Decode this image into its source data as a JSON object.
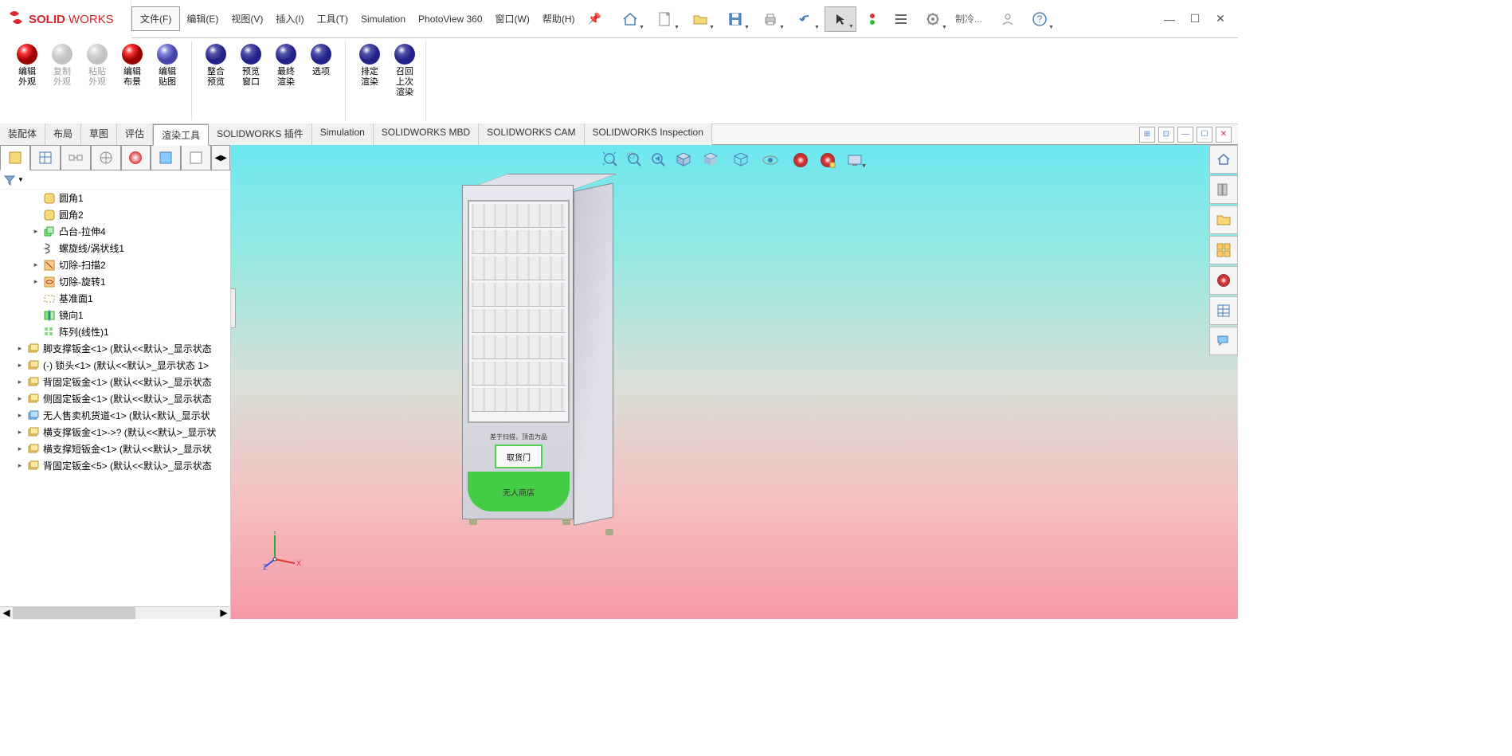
{
  "logo": "SOLIDWORKS",
  "menu": {
    "file": "文件(F)",
    "edit": "编辑(E)",
    "view": "视图(V)",
    "insert": "插入(I)",
    "tools": "工具(T)",
    "simulation": "Simulation",
    "photoview": "PhotoView 360",
    "window": "窗口(W)",
    "help": "帮助(H)"
  },
  "searchPlaceholder": "制冷...",
  "ribbon": {
    "items": [
      {
        "label": "编辑\n外观",
        "icon": "appearance"
      },
      {
        "label": "复制\n外观",
        "icon": "copy-appearance",
        "disabled": true
      },
      {
        "label": "粘贴\n外观",
        "icon": "paste-appearance",
        "disabled": true
      },
      {
        "label": "编辑\n布景",
        "icon": "scene"
      },
      {
        "label": "编辑\n贴图",
        "icon": "decal"
      },
      {
        "label": "整合\n预览",
        "icon": "integrated-preview"
      },
      {
        "label": "预览\n窗口",
        "icon": "preview-window"
      },
      {
        "label": "最终\n渲染",
        "icon": "final-render"
      },
      {
        "label": "选项",
        "icon": "options"
      },
      {
        "label": "排定\n渲染",
        "icon": "schedule"
      },
      {
        "label": "召回\n上次\n渲染",
        "icon": "recall"
      }
    ]
  },
  "tabs": [
    "装配体",
    "布局",
    "草图",
    "评估",
    "渲染工具",
    "SOLIDWORKS 插件",
    "Simulation",
    "SOLIDWORKS MBD",
    "SOLIDWORKS CAM",
    "SOLIDWORKS Inspection"
  ],
  "activeTab": 4,
  "tree": [
    {
      "label": "圆角1",
      "indent": 2,
      "icon": "fillet"
    },
    {
      "label": "圆角2",
      "indent": 2,
      "icon": "fillet"
    },
    {
      "label": "凸台-拉伸4",
      "indent": 2,
      "icon": "extrude",
      "expand": true
    },
    {
      "label": "螺旋线/涡状线1",
      "indent": 2,
      "icon": "helix"
    },
    {
      "label": "切除-扫描2",
      "indent": 2,
      "icon": "sweep-cut",
      "expand": true
    },
    {
      "label": "切除-旋转1",
      "indent": 2,
      "icon": "revolve-cut",
      "expand": true
    },
    {
      "label": "基准面1",
      "indent": 2,
      "icon": "plane"
    },
    {
      "label": "镜向1",
      "indent": 2,
      "icon": "mirror"
    },
    {
      "label": "阵列(线性)1",
      "indent": 2,
      "icon": "pattern"
    },
    {
      "label": "脚支撑钣金<1> (默认<<默认>_显示状态",
      "indent": 1,
      "icon": "part",
      "expand": true
    },
    {
      "label": "(-) 锁头<1> (默认<<默认>_显示状态 1>",
      "indent": 1,
      "icon": "part",
      "expand": true
    },
    {
      "label": "背固定钣金<1> (默认<<默认>_显示状态",
      "indent": 1,
      "icon": "part",
      "expand": true
    },
    {
      "label": "侧固定钣金<1> (默认<<默认>_显示状态",
      "indent": 1,
      "icon": "part",
      "expand": true
    },
    {
      "label": "无人售卖机货道<1> (默认<默认_显示状",
      "indent": 1,
      "icon": "asm",
      "expand": true
    },
    {
      "label": "横支撑钣金<1>->? (默认<<默认>_显示状",
      "indent": 1,
      "icon": "part",
      "expand": true
    },
    {
      "label": "横支撑短钣金<1> (默认<<默认>_显示状",
      "indent": 1,
      "icon": "part",
      "expand": true
    },
    {
      "label": "背固定钣金<5> (默认<<默认>_显示状态",
      "indent": 1,
      "icon": "part",
      "expand": true
    }
  ],
  "model": {
    "pickupHint": "差于扫描，顶击为品",
    "pickupDoor": "取货门",
    "storeName": "无人商店"
  },
  "triad": {
    "x": "X",
    "y": "Y",
    "z": "Z"
  }
}
